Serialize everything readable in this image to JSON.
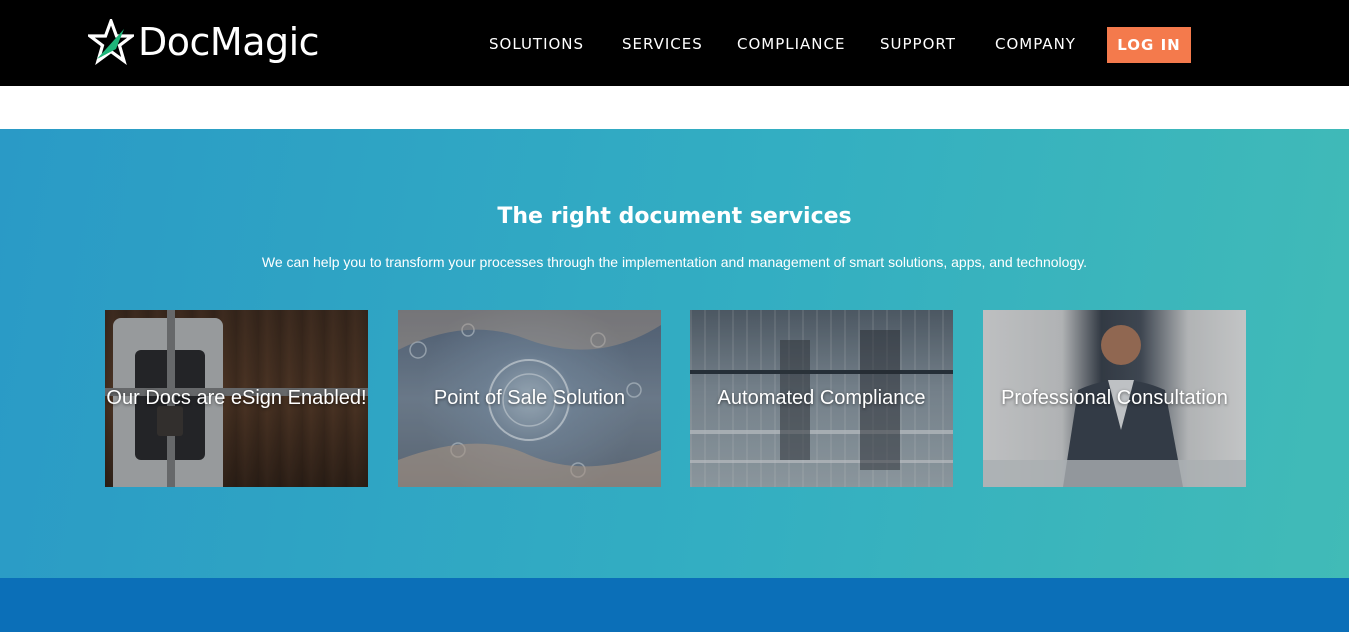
{
  "header": {
    "logo_text": "DocMagic",
    "nav": [
      {
        "label": "SOLUTIONS"
      },
      {
        "label": "SERVICES"
      },
      {
        "label": "COMPLIANCE"
      },
      {
        "label": "SUPPORT"
      },
      {
        "label": "COMPANY"
      }
    ],
    "login_label": "LOG IN"
  },
  "services": {
    "title": "The right document services",
    "subtitle": "We can help you to transform your processes through the implementation and management of smart solutions, apps, and technology.",
    "cards": [
      {
        "label": "Our Docs are eSign Enabled!"
      },
      {
        "label": "Point of Sale Solution"
      },
      {
        "label": "Automated Compliance"
      },
      {
        "label": "Professional Consultation"
      }
    ]
  },
  "colors": {
    "header_bg": "#000000",
    "accent": "#f47a4c",
    "logo_star_accent": "#1fb57a",
    "services_bg_start": "#2a9ac6",
    "services_bg_end": "#41bbb7",
    "bottom_band": "#0b6fb8"
  }
}
